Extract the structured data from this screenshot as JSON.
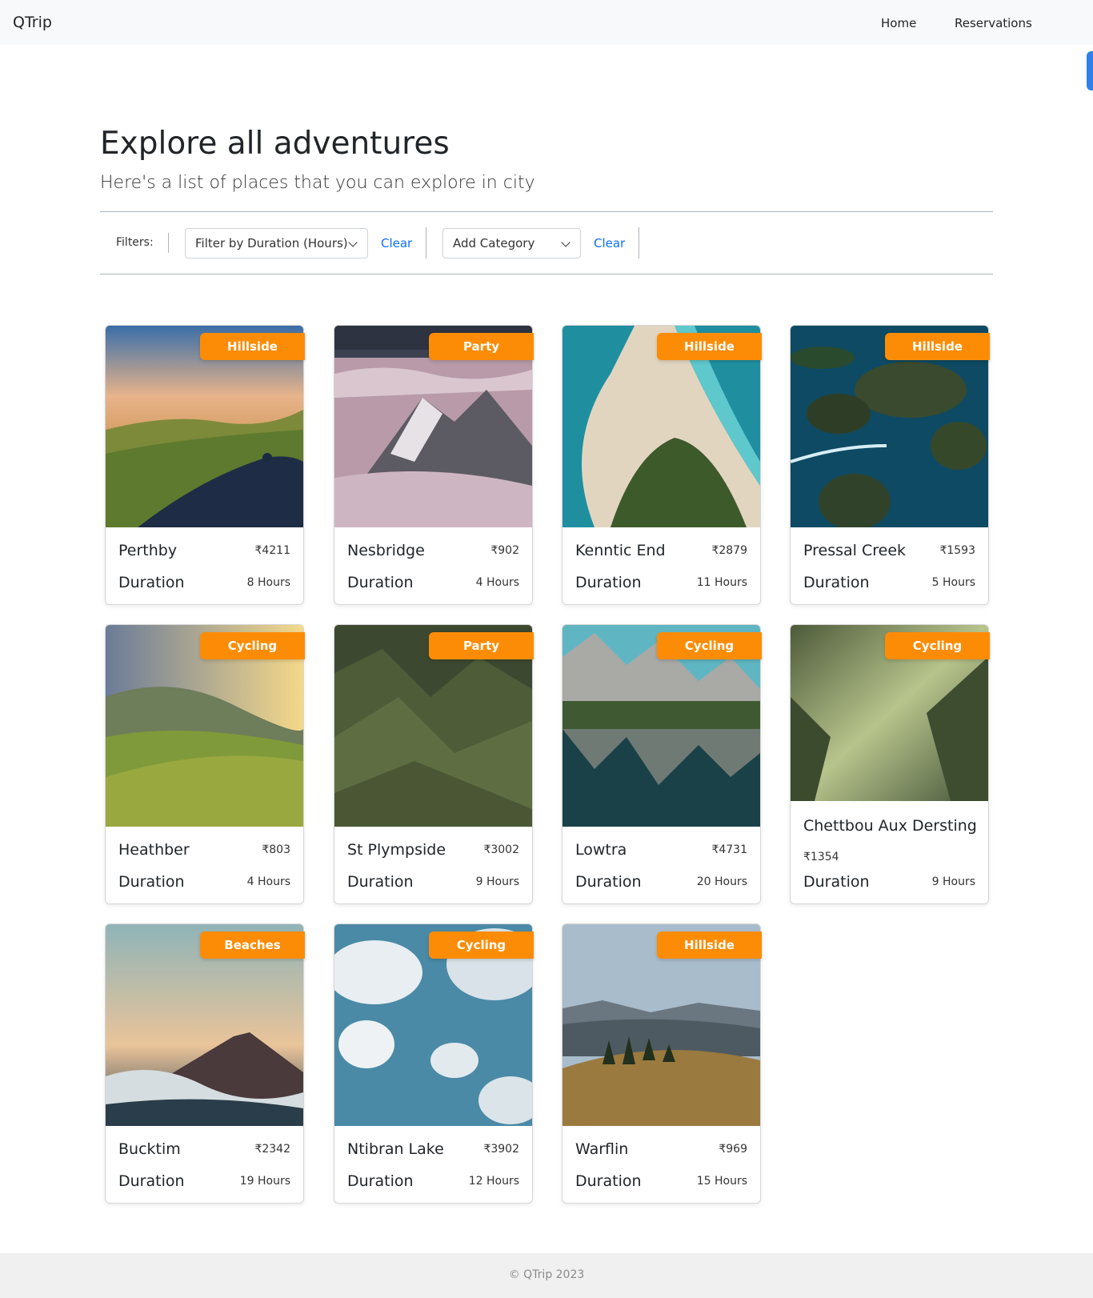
{
  "nav": {
    "brand": "QTrip",
    "links": [
      {
        "label": "Home"
      },
      {
        "label": "Reservations"
      }
    ]
  },
  "header": {
    "title": "Explore all adventures",
    "subtitle": "Here's a list of places that you can explore in city"
  },
  "filters": {
    "label": "Filters:",
    "duration_select": "Filter by Duration (Hours)",
    "clear_duration": "Clear",
    "category_select": "Add Category",
    "clear_category": "Clear"
  },
  "adventures": [
    {
      "name": "Perthby",
      "price": "₹4211",
      "duration_label": "Duration",
      "duration": "8 Hours",
      "category": "Hillside",
      "image": "cyclist-on-hill-road"
    },
    {
      "name": "Nesbridge",
      "price": "₹902",
      "duration_label": "Duration",
      "duration": "4 Hours",
      "category": "Party",
      "image": "snowy-peak-above-clouds"
    },
    {
      "name": "Kenntic End",
      "price": "₹2879",
      "duration_label": "Duration",
      "duration": "11 Hours",
      "category": "Hillside",
      "image": "aerial-beach-spit"
    },
    {
      "name": "Pressal Creek",
      "price": "₹1593",
      "duration_label": "Duration",
      "duration": "5 Hours",
      "category": "Hillside",
      "image": "island-lagoon"
    },
    {
      "name": "Heathber",
      "price": "₹803",
      "duration_label": "Duration",
      "duration": "4 Hours",
      "category": "Cycling",
      "image": "green-terraced-hills"
    },
    {
      "name": "St Plympside",
      "price": "₹3002",
      "duration_label": "Duration",
      "duration": "9 Hours",
      "category": "Party",
      "image": "green-mountain-ridges"
    },
    {
      "name": "Lowtra",
      "price": "₹4731",
      "duration_label": "Duration",
      "duration": "20 Hours",
      "category": "Cycling",
      "image": "mountain-lake-reflection"
    },
    {
      "name": "Chettbou Aux Dersting",
      "price": "₹1354",
      "duration_label": "Duration",
      "duration": "9 Hours",
      "category": "Cycling",
      "image": "misty-green-valley"
    },
    {
      "name": "Bucktim",
      "price": "₹2342",
      "duration_label": "Duration",
      "duration": "19 Hours",
      "category": "Beaches",
      "image": "volcano-sunset"
    },
    {
      "name": "Ntibran Lake",
      "price": "₹3902",
      "duration_label": "Duration",
      "duration": "12 Hours",
      "category": "Cycling",
      "image": "blue-sky-clouds"
    },
    {
      "name": "Warflin",
      "price": "₹969",
      "duration_label": "Duration",
      "duration": "15 Hours",
      "category": "Hillside",
      "image": "golden-hills-pines"
    }
  ],
  "footer": {
    "text": "© QTrip 2023"
  },
  "colors": {
    "badge": "#fc8c06",
    "link": "#0d6efd",
    "navbar_bg": "#f8f9fa",
    "footer_bg": "#f0f0f0"
  }
}
